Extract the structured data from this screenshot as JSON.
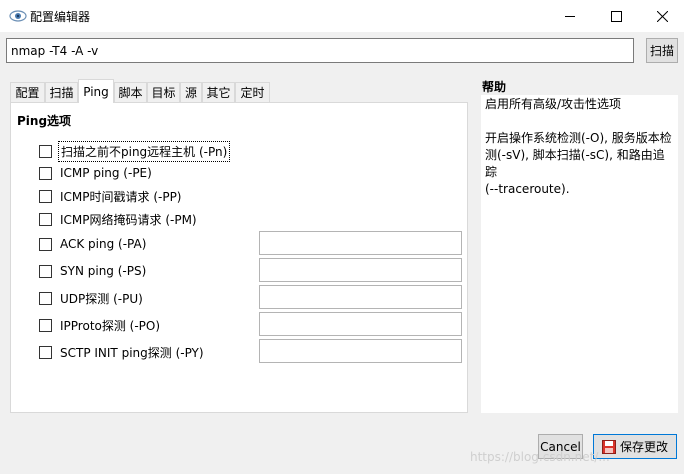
{
  "window": {
    "title": "配置编辑器",
    "icon": "eye-icon",
    "controls": [
      "minimize-icon",
      "maximize-icon",
      "close-icon"
    ]
  },
  "command": {
    "value": "nmap -T4 -A -v",
    "scan_label": "扫描"
  },
  "tabs": [
    {
      "label": "配置",
      "active": false
    },
    {
      "label": "扫描",
      "active": false
    },
    {
      "label": "Ping",
      "active": true
    },
    {
      "label": "脚本",
      "active": false
    },
    {
      "label": "目标",
      "active": false
    },
    {
      "label": "源",
      "active": false
    },
    {
      "label": "其它",
      "active": false
    },
    {
      "label": "定时",
      "active": false
    }
  ],
  "ping": {
    "group_title": "Ping选项",
    "options": [
      {
        "label": "扫描之前不ping远程主机 (-Pn)",
        "checked": false,
        "has_field": false,
        "focused": true,
        "value": ""
      },
      {
        "label": "ICMP ping (-PE)",
        "checked": false,
        "has_field": false,
        "focused": false,
        "value": ""
      },
      {
        "label": "ICMP时间戳请求 (-PP)",
        "checked": false,
        "has_field": false,
        "focused": false,
        "value": ""
      },
      {
        "label": "ICMP网络掩码请求 (-PM)",
        "checked": false,
        "has_field": false,
        "focused": false,
        "value": ""
      },
      {
        "label": "ACK ping (-PA)",
        "checked": false,
        "has_field": true,
        "focused": false,
        "value": ""
      },
      {
        "label": "SYN ping (-PS)",
        "checked": false,
        "has_field": true,
        "focused": false,
        "value": ""
      },
      {
        "label": "UDP探测 (-PU)",
        "checked": false,
        "has_field": true,
        "focused": false,
        "value": ""
      },
      {
        "label": "IPProto探测 (-PO)",
        "checked": false,
        "has_field": true,
        "focused": false,
        "value": ""
      },
      {
        "label": "SCTP INIT ping探测 (-PY)",
        "checked": false,
        "has_field": true,
        "focused": false,
        "value": ""
      }
    ]
  },
  "help": {
    "title": "帮助",
    "lines": [
      "启用所有高级/攻击性选项",
      "",
      "开启操作系统检测(-O), 服务版本检",
      "测(-sV), 脚本扫描(-sC), 和路由追踪",
      "(--traceroute)."
    ]
  },
  "footer": {
    "cancel_label": "Cancel",
    "save_label": "保存更改"
  },
  "watermark": "https://blog.csdn.net/...",
  "colors": {
    "focus_border": "#0078d7",
    "save_icon_red": "#d9342b"
  }
}
